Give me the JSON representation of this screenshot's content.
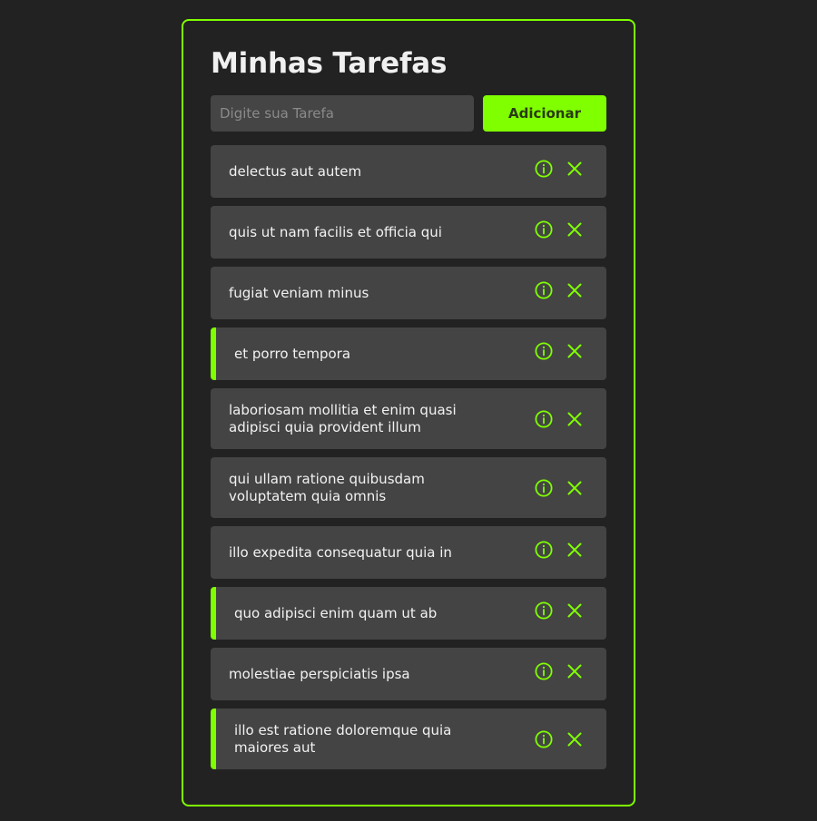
{
  "app": {
    "title": "Minhas Tarefas"
  },
  "form": {
    "input_placeholder": "Digite sua Tarefa",
    "input_value": "",
    "add_label": "Adicionar"
  },
  "tasks": [
    {
      "title": "delectus aut autem",
      "completed": false
    },
    {
      "title": "quis ut nam facilis et officia qui",
      "completed": false
    },
    {
      "title": "fugiat veniam minus",
      "completed": false
    },
    {
      "title": "et porro tempora",
      "completed": true
    },
    {
      "title": "laboriosam mollitia et enim quasi adipisci quia provident illum",
      "completed": false
    },
    {
      "title": "qui ullam ratione quibusdam voluptatem quia omnis",
      "completed": false
    },
    {
      "title": "illo expedita consequatur quia in",
      "completed": false
    },
    {
      "title": "quo adipisci enim quam ut ab",
      "completed": true
    },
    {
      "title": "molestiae perspiciatis ipsa",
      "completed": false
    },
    {
      "title": "illo est ratione doloremque quia maiores aut",
      "completed": true
    }
  ],
  "icons": {
    "info": "info-icon",
    "remove": "close-icon"
  },
  "colors": {
    "accent": "#7fff00",
    "background": "#222222",
    "item_background": "#444444",
    "text": "#f2f2f2"
  }
}
